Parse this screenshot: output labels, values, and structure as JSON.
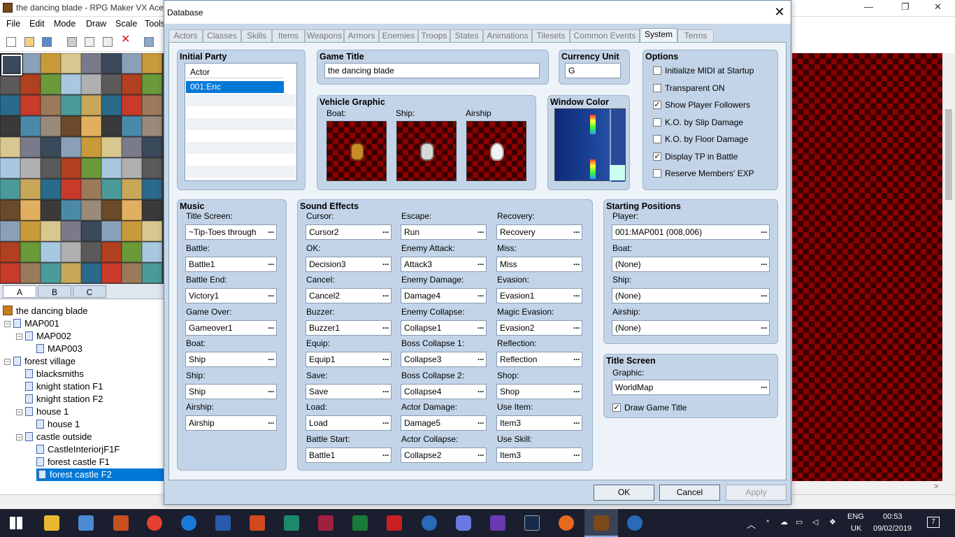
{
  "main_window": {
    "title": "the dancing blade - RPG Maker VX Ace",
    "menu": [
      "File",
      "Edit",
      "Mode",
      "Draw",
      "Scale",
      "Tools"
    ]
  },
  "tileset_tabs": [
    "A",
    "B",
    "C"
  ],
  "map_tree": {
    "project": "the dancing blade",
    "items": [
      {
        "label": "MAP001",
        "level": 1,
        "expander": "-"
      },
      {
        "label": "MAP002",
        "level": 2,
        "expander": "-"
      },
      {
        "label": "MAP003",
        "level": 3,
        "expander": ""
      },
      {
        "label": "forest village",
        "level": 1,
        "expander": "-"
      },
      {
        "label": "blacksmiths",
        "level": 2,
        "expander": ""
      },
      {
        "label": "knight station F1",
        "level": 2,
        "expander": ""
      },
      {
        "label": "knight station F2",
        "level": 2,
        "expander": ""
      },
      {
        "label": "house 1",
        "level": 2,
        "expander": "-"
      },
      {
        "label": "house 1",
        "level": 3,
        "expander": ""
      },
      {
        "label": "castle outside",
        "level": 2,
        "expander": "-"
      },
      {
        "label": "CastleInteriorjF1F",
        "level": 3,
        "expander": ""
      },
      {
        "label": "forest castle F1",
        "level": 3,
        "expander": ""
      },
      {
        "label": "forest castle F2",
        "level": 3,
        "expander": "",
        "selected": true
      }
    ]
  },
  "dialog": {
    "title": "Database",
    "tabs": [
      "Actors",
      "Classes",
      "Skills",
      "Items",
      "Weapons",
      "Armors",
      "Enemies",
      "Troops",
      "States",
      "Animations",
      "Tilesets",
      "Common Events",
      "System",
      "Terms"
    ],
    "selected_tab": "System",
    "initial_party": {
      "header": "Initial Party",
      "column": "Actor",
      "members": [
        "001:Eric"
      ]
    },
    "game_title": {
      "header": "Game Title",
      "value": "the dancing blade"
    },
    "currency": {
      "header": "Currency Unit",
      "value": "G"
    },
    "vehicle_graphic": {
      "header": "Vehicle Graphic",
      "boat": "Boat:",
      "ship": "Ship:",
      "airship": "Airship"
    },
    "window_color": {
      "header": "Window Color"
    },
    "options": {
      "header": "Options",
      "items": [
        {
          "label": "Initialize MIDI at Startup",
          "checked": false
        },
        {
          "label": "Transparent ON",
          "checked": false
        },
        {
          "label": "Show Player Followers",
          "checked": true
        },
        {
          "label": "K.O. by Slip Damage",
          "checked": false
        },
        {
          "label": "K.O. by Floor Damage",
          "checked": false
        },
        {
          "label": "Display TP in Battle",
          "checked": true
        },
        {
          "label": "Reserve Members' EXP",
          "checked": false
        }
      ]
    },
    "music": {
      "header": "Music",
      "items": [
        {
          "label": "Title Screen:",
          "value": "~Tip-Toes through"
        },
        {
          "label": "Battle:",
          "value": "Battle1"
        },
        {
          "label": "Battle End:",
          "value": "Victory1"
        },
        {
          "label": "Game Over:",
          "value": "Gameover1"
        },
        {
          "label": "Boat:",
          "value": "Ship"
        },
        {
          "label": "Ship:",
          "value": "Ship"
        },
        {
          "label": "Airship:",
          "value": "Airship"
        }
      ]
    },
    "sound_effects": {
      "header": "Sound Effects",
      "columns": [
        [
          {
            "label": "Cursor:",
            "value": "Cursor2"
          },
          {
            "label": "OK:",
            "value": "Decision3"
          },
          {
            "label": "Cancel:",
            "value": "Cancel2"
          },
          {
            "label": "Buzzer:",
            "value": "Buzzer1"
          },
          {
            "label": "Equip:",
            "value": "Equip1"
          },
          {
            "label": "Save:",
            "value": "Save"
          },
          {
            "label": "Load:",
            "value": "Load"
          },
          {
            "label": "Battle Start:",
            "value": "Battle1"
          }
        ],
        [
          {
            "label": "Escape:",
            "value": "Run"
          },
          {
            "label": "Enemy Attack:",
            "value": "Attack3"
          },
          {
            "label": "Enemy Damage:",
            "value": "Damage4"
          },
          {
            "label": "Enemy Collapse:",
            "value": "Collapse1"
          },
          {
            "label": "Boss Collapse 1:",
            "value": "Collapse3"
          },
          {
            "label": "Boss Collapse 2:",
            "value": "Collapse4"
          },
          {
            "label": "Actor Damage:",
            "value": "Damage5"
          },
          {
            "label": "Actor Collapse:",
            "value": "Collapse2"
          }
        ],
        [
          {
            "label": "Recovery:",
            "value": "Recovery"
          },
          {
            "label": "Miss:",
            "value": "Miss"
          },
          {
            "label": "Evasion:",
            "value": "Evasion1"
          },
          {
            "label": "Magic Evasion:",
            "value": "Evasion2"
          },
          {
            "label": "Reflection:",
            "value": "Reflection"
          },
          {
            "label": "Shop:",
            "value": "Shop"
          },
          {
            "label": "Use Item:",
            "value": "Item3"
          },
          {
            "label": "Use Skill:",
            "value": "Item3"
          }
        ]
      ]
    },
    "starting_positions": {
      "header": "Starting Positions",
      "items": [
        {
          "label": "Player:",
          "value": "001:MAP001 (008,006)"
        },
        {
          "label": "Boat:",
          "value": "(None)"
        },
        {
          "label": "Ship:",
          "value": "(None)"
        },
        {
          "label": "Airship:",
          "value": "(None)"
        }
      ]
    },
    "title_screen": {
      "header": "Title Screen",
      "graphic_label": "Graphic:",
      "graphic": "WorldMap",
      "draw_title_label": "Draw Game Title",
      "draw_title": true
    },
    "buttons": {
      "ok": "OK",
      "cancel": "Cancel",
      "apply": "Apply"
    }
  },
  "taskbar": {
    "lang": "ENG",
    "region": "UK",
    "time": "00:53",
    "date": "09/02/2019",
    "notif": "7"
  },
  "colors": {
    "accent": "#0078d7",
    "panel": "#c3d4e8",
    "checker_dark": "#3a0000",
    "checker_light": "#8b0000"
  }
}
